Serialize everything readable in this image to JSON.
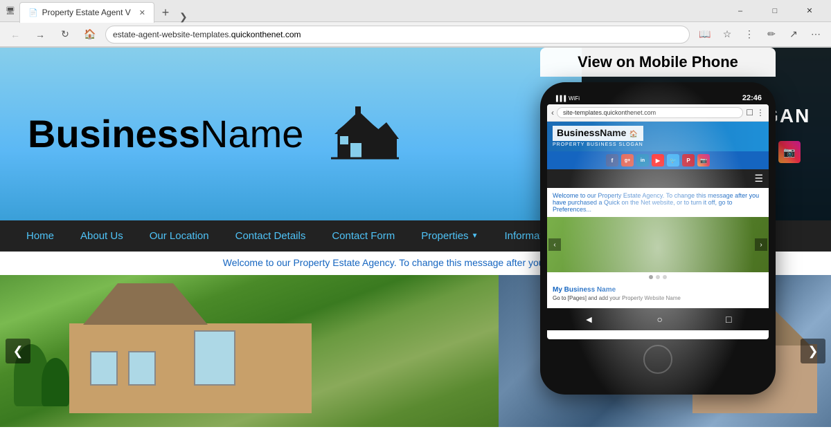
{
  "browser": {
    "title": "Property Estate Agent V",
    "url_prefix": "estate-agent-website-templates.",
    "url_domain": "quickonthenet.com",
    "tab_label": "Property Estate Agent V"
  },
  "mobile_overlay": {
    "label": "View on Mobile Phone"
  },
  "site": {
    "business_name_bold": "Business",
    "business_name_light": "Name",
    "slogan": "BUSINESS SLOGAN",
    "welcome_text": "Welcome to our Property Estate Agency. To change this message after you have purcha...",
    "nav": {
      "home": "Home",
      "about": "About Us",
      "location": "Our Location",
      "contact_details": "Contact Details",
      "contact_form": "Contact Form",
      "properties": "Properties",
      "information": "Informati..."
    }
  },
  "phone": {
    "time": "22:46",
    "url": "site-templates.quickonthenet.com",
    "biz_name": "BusinessName",
    "slogan_sm": "PROPERTY BUSINESS SLOGAN",
    "welcome_text": "Welcome to our Property Estate Agency. To change this message after you have purchased a Quick on the Net website, or to turn it off, go to Preferences...",
    "biz_title": "My Business Name",
    "biz_desc": "Go to [Pages] and add your Property Website Name"
  },
  "social": {
    "icons": [
      "f",
      "g+",
      "in",
      "▶",
      "t",
      "p",
      "📷"
    ]
  }
}
